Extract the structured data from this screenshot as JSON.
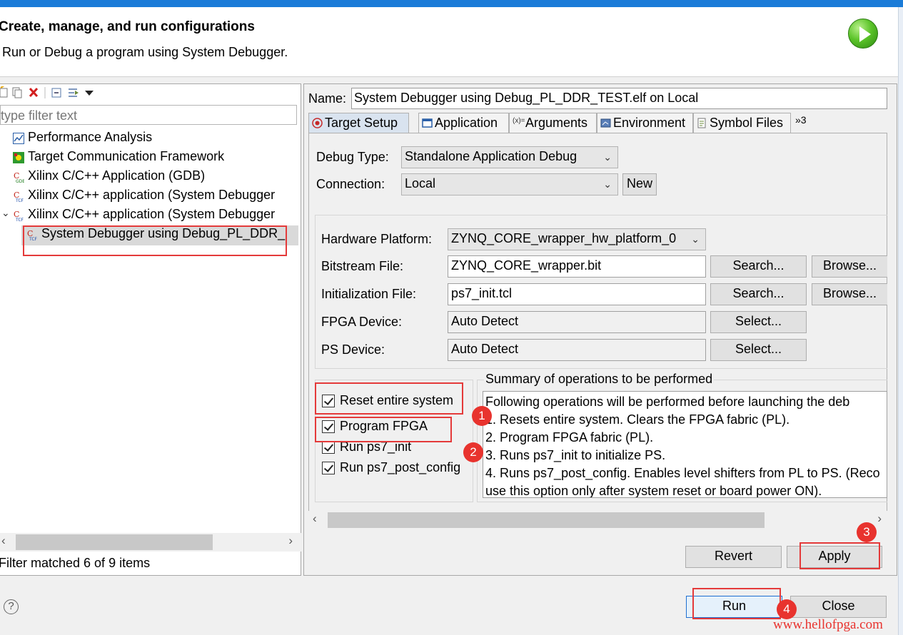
{
  "header": {
    "title": "Create, manage, and run configurations",
    "subtitle": "Run or Debug a program using System Debugger."
  },
  "left": {
    "toolbar_icons": [
      "new-config-icon",
      "duplicate-icon",
      "delete-icon",
      "collapse-all-icon",
      "filter-icon",
      "view-menu-icon"
    ],
    "filter_placeholder": "type filter text",
    "tree": [
      {
        "label": "Performance Analysis",
        "icon": "performance-icon"
      },
      {
        "label": "Target Communication Framework",
        "icon": "tcf-icon"
      },
      {
        "label": "Xilinx C/C++ Application (GDB)",
        "icon": "gdb-icon"
      },
      {
        "label": "Xilinx C/C++ application (System Debugger",
        "icon": "tcf-debug-icon"
      },
      {
        "label": "Xilinx C/C++ application (System Debugger",
        "icon": "tcf-debug-icon",
        "expanded": true
      },
      {
        "label": "System Debugger using Debug_PL_DDR_",
        "icon": "tcf-debug-icon",
        "selected": true
      }
    ],
    "status": "Filter matched 6 of 9 items"
  },
  "right": {
    "name_label": "Name:",
    "name_value": "System Debugger using Debug_PL_DDR_TEST.elf on Local",
    "tabs": [
      {
        "label": "Target Setup",
        "active": true
      },
      {
        "label": "Application"
      },
      {
        "label": "Arguments"
      },
      {
        "label": "Environment"
      },
      {
        "label": "Symbol Files"
      }
    ],
    "tab_overflow": "»3",
    "debug_type_label": "Debug Type:",
    "debug_type_value": "Standalone Application Debug",
    "connection_label": "Connection:",
    "connection_value": "Local",
    "new_button": "New",
    "hardware_platform_label": "Hardware Platform:",
    "hardware_platform_value": "ZYNQ_CORE_wrapper_hw_platform_0",
    "bitstream_label": "Bitstream File:",
    "bitstream_value": "ZYNQ_CORE_wrapper.bit",
    "init_label": "Initialization File:",
    "init_value": "ps7_init.tcl",
    "fpga_label": "FPGA Device:",
    "fpga_value": "Auto Detect",
    "ps_label": "PS Device:",
    "ps_value": "Auto Detect",
    "search_label": "Search...",
    "browse_label": "Browse...",
    "select_label": "Select...",
    "checkboxes": [
      {
        "label": "Reset entire system",
        "checked": true
      },
      {
        "label": "Program FPGA",
        "checked": true
      },
      {
        "label": "Run ps7_init",
        "checked": true
      },
      {
        "label": "Run ps7_post_config",
        "checked": true
      }
    ],
    "summary_title": "Summary of operations to be performed",
    "summary_lines": [
      "Following operations will be performed before launching the deb",
      "1. Resets entire system. Clears the FPGA fabric (PL).",
      "2. Program FPGA fabric (PL).",
      "3. Runs ps7_init to initialize PS.",
      "4. Runs ps7_post_config. Enables level shifters from PL to PS. (Reco",
      "use this option only after system reset or board power ON)."
    ],
    "revert_button": "Revert",
    "apply_button": "Apply"
  },
  "footer": {
    "help_icon": "?",
    "run_button": "Run",
    "close_button": "Close"
  },
  "annotations": {
    "badges": [
      "1",
      "2",
      "3",
      "4"
    ],
    "highlight_color": "#e43a3a"
  },
  "watermark": "www.hellofpga.com"
}
